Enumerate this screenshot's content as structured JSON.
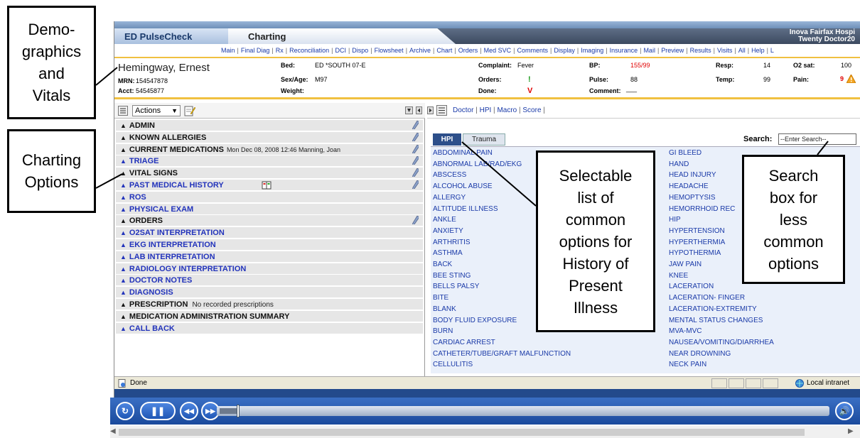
{
  "annotations": {
    "demographics": "Demo-\ngraphics\nand\nVitals",
    "charting": "Charting\nOptions",
    "selectable": "Selectable\nlist of\ncommon\noptions for\nHistory of\nPresent\nIllness",
    "search": "Search\nbox for\nless\ncommon\noptions"
  },
  "header": {
    "app_title": "ED PulseCheck",
    "page_title": "Charting",
    "hospital_line1": "Inova Fairfax Hospi",
    "hospital_line2": "Twenty Doctor20"
  },
  "nav": [
    "Main",
    "Final Diag",
    "Rx",
    "Reconciliation",
    "DCI",
    "Dispo",
    "Flowsheet",
    "Archive",
    "Chart",
    "Orders",
    "Med SVC",
    "Comments",
    "Display",
    "Imaging",
    "Insurance",
    "Mail",
    "Preview",
    "Results",
    "Visits",
    "All",
    "Help",
    "L"
  ],
  "patient": {
    "name": "Hemingway, Ernest",
    "mrn_label": "MRN:",
    "mrn": "154547878",
    "acct_label": "Acct:",
    "acct": "54545877",
    "bed_label": "Bed:",
    "bed": "ED *SOUTH 07-E",
    "sexage_label": "Sex/Age:",
    "sexage": "M97",
    "weight_label": "Weight:",
    "complaint_label": "Complaint:",
    "complaint": "Fever",
    "orders_label": "Orders:",
    "orders": "!",
    "done_label": "Done:",
    "done": "V",
    "bp_label": "BP:",
    "bp": "155/99",
    "pulse_label": "Pulse:",
    "pulse": "88",
    "comment_label": "Comment:",
    "comment": "___",
    "resp_label": "Resp:",
    "resp": "14",
    "temp_label": "Temp:",
    "temp": "99",
    "o2_label": "O2 sat:",
    "o2": "100",
    "pain_label": "Pain:",
    "pain": "9"
  },
  "left_toolbar": {
    "actions": "Actions"
  },
  "sections": [
    {
      "label": "ADMIN",
      "style": "black",
      "pencil": true,
      "note": ""
    },
    {
      "label": "KNOWN ALLERGIES",
      "style": "black",
      "pencil": true,
      "note": ""
    },
    {
      "label": "CURRENT MEDICATIONS",
      "style": "black",
      "pencil": true,
      "note": "Mon Dec 08, 2008 12:46 Manning, Joan"
    },
    {
      "label": "TRIAGE",
      "style": "blue",
      "pencil": true,
      "note": ""
    },
    {
      "label": "VITAL SIGNS",
      "style": "black",
      "pencil": true,
      "note": ""
    },
    {
      "label": "PAST MEDICAL HISTORY",
      "style": "blue",
      "pencil": true,
      "note": ""
    },
    {
      "label": "ROS",
      "style": "blue",
      "pencil": false,
      "note": ""
    },
    {
      "label": "PHYSICAL EXAM",
      "style": "blue",
      "pencil": false,
      "note": ""
    },
    {
      "label": "ORDERS",
      "style": "black",
      "pencil": true,
      "note": ""
    },
    {
      "label": "O2SAT INTERPRETATION",
      "style": "blue",
      "pencil": false,
      "note": ""
    },
    {
      "label": "EKG INTERPRETATION",
      "style": "blue",
      "pencil": false,
      "note": ""
    },
    {
      "label": "LAB INTERPRETATION",
      "style": "blue",
      "pencil": false,
      "note": ""
    },
    {
      "label": "RADIOLOGY INTERPRETATION",
      "style": "blue",
      "pencil": false,
      "note": ""
    },
    {
      "label": "DOCTOR NOTES",
      "style": "blue",
      "pencil": false,
      "note": ""
    },
    {
      "label": "DIAGNOSIS",
      "style": "blue",
      "pencil": false,
      "note": ""
    },
    {
      "label": "PRESCRIPTION",
      "style": "black",
      "pencil": false,
      "note2": "No recorded prescriptions"
    },
    {
      "label": "MEDICATION ADMINISTRATION SUMMARY",
      "style": "black",
      "pencil": false,
      "note": ""
    },
    {
      "label": "CALL BACK",
      "style": "blue",
      "pencil": false,
      "note": ""
    }
  ],
  "right_toolbar": {
    "links": [
      "Doctor",
      "HPI",
      "Macro",
      "Score"
    ]
  },
  "hpi_tabs": {
    "hpi": "HPI",
    "trauma": "Trauma"
  },
  "search": {
    "label": "Search:",
    "placeholder": "--Enter Search--"
  },
  "hpi_col1": [
    "ABDOMINAL PAIN",
    "ABNORMAL LAB/RAD/EKG",
    "ABSCESS",
    "ALCOHOL ABUSE",
    "ALLERGY",
    "ALTITUDE ILLNESS",
    "ANKLE",
    "ANXIETY",
    "ARTHRITIS",
    "ASTHMA",
    "BACK",
    "BEE STING",
    "BELLS PALSY",
    "BITE",
    "BLANK",
    "BODY FLUID EXPOSURE",
    "BURN",
    "CARDIAC ARREST",
    "CATHETER/TUBE/GRAFT MALFUNCTION",
    "CELLULITIS"
  ],
  "hpi_col2": [
    "GI BLEED",
    "HAND",
    "HEAD INJURY",
    "HEADACHE",
    "HEMOPTYSIS",
    "HEMORRHOID REC",
    "HIP",
    "HYPERTENSION",
    "HYPERTHERMIA",
    "HYPOTHERMIA",
    "JAW PAIN",
    "KNEE",
    "LACERATION",
    "LACERATION- FINGER",
    "LACERATION-EXTREMITY",
    "MENTAL STATUS CHANGES",
    "MVA-MVC",
    "NAUSEA/VOMITING/DIARRHEA",
    "NEAR DROWNING",
    "NECK PAIN"
  ],
  "status": {
    "left": "Done",
    "right": "Local intranet"
  },
  "colors": {
    "accent": "#f0c040",
    "link": "#1a3aa8",
    "header": "#3c4a60",
    "bp_red": "#e00000"
  }
}
